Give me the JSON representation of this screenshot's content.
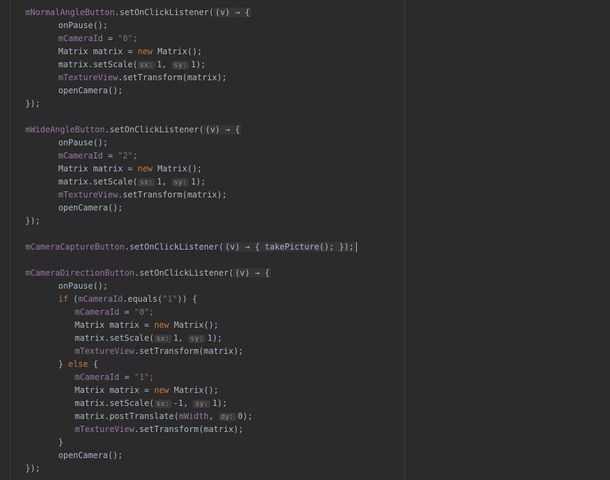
{
  "code": {
    "normal_field": "mNormalAngleButton",
    "wide_field": "mWideAngleButton",
    "capture_field": "mCameraCaptureButton",
    "direction_field": "mCameraDirectionButton",
    "set_listener": ".setOnClickListener(",
    "lambda": "(v) → {",
    "on_pause": "onPause();",
    "camera_id_field": "mCameraId",
    "assign": " = ",
    "id_0": "\"0\"",
    "id_2": "\"2\"",
    "id_1": "\"1\"",
    "semi": ";",
    "matrix_type_decl": "Matrix matrix = ",
    "new_kw": "new",
    "matrix_ctor": " Matrix();",
    "set_scale": "matrix.setScale(",
    "hint_sx": "sx:",
    "hint_sy": "sy:",
    "hint_dy": "dy:",
    "scale_1": "1, ",
    "scale_neg1": "-1, ",
    "scale_end": "1);",
    "texture_field": "mTextureView",
    "set_transform": ".setTransform(matrix);",
    "open_camera": "openCamera();",
    "close_listener": "});",
    "capture_lambda": "(v) → { takePicture(); });",
    "if_kw": "if",
    "if_open": " (",
    "equals_call": ".equals(",
    "if_close": ")) {",
    "close_brace": "}",
    "else_kw": "else",
    "else_open": " {",
    "post_translate": "matrix.postTranslate(",
    "width_field": "mWidth",
    "comma_space": ", ",
    "translate_end": "0);"
  }
}
